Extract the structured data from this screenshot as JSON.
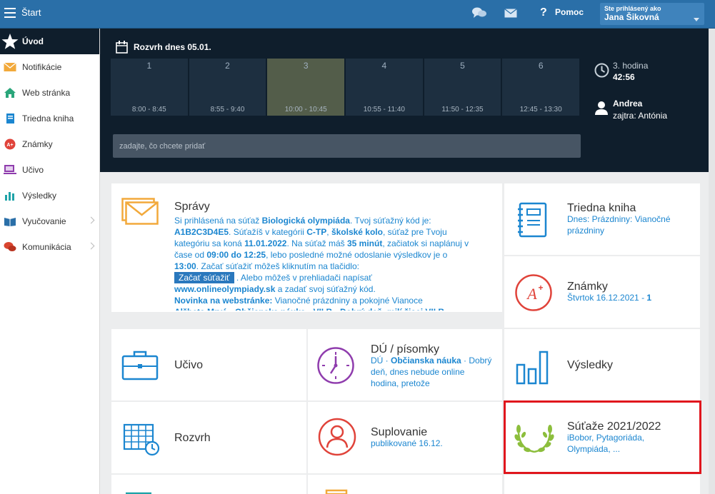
{
  "topbar": {
    "title": "Štart",
    "help_label": "Pomoc",
    "help_icon": "?",
    "user_caption": "Ste prihlásený ako",
    "user_name": "Jana Šikovná"
  },
  "sidebar": {
    "items": [
      {
        "label": "Úvod",
        "icon": "star-icon"
      },
      {
        "label": "Notifikácie",
        "icon": "envelope-icon"
      },
      {
        "label": "Web stránka",
        "icon": "home-icon"
      },
      {
        "label": "Triedna kniha",
        "icon": "book-icon"
      },
      {
        "label": "Známky",
        "icon": "grade-icon"
      },
      {
        "label": "Učivo",
        "icon": "monitor-icon"
      },
      {
        "label": "Výsledky",
        "icon": "chart-icon"
      },
      {
        "label": "Vyučovanie",
        "icon": "open-book-icon"
      },
      {
        "label": "Komunikácia",
        "icon": "chat-icon"
      }
    ]
  },
  "schedule": {
    "title": "Rozvrh dnes 05.01.",
    "slots": [
      {
        "num": "1",
        "time": "8:00 - 8:45"
      },
      {
        "num": "2",
        "time": "8:55 - 9:40"
      },
      {
        "num": "3",
        "time": "10:00 - 10:45"
      },
      {
        "num": "4",
        "time": "10:55 - 11:40"
      },
      {
        "num": "5",
        "time": "11:50 - 12:35"
      },
      {
        "num": "6",
        "time": "12:45 - 13:30"
      }
    ],
    "current_lesson": "3. hodina",
    "remaining": "42:56",
    "nameday_today": "Andrea",
    "nameday_tomorrow": "zajtra: Antónia",
    "input_placeholder": "zadajte, čo chcete pridať"
  },
  "tiles": {
    "spravy": {
      "title": "Správy",
      "p1": "Si prihlásená na súťaž ",
      "p1b": "Biologická olympiáda",
      "p2": ". Tvoj súťažný kód je: ",
      "code": "A1B2C3D4E5",
      "p3": ". Súťažíš v kategórii ",
      "category": "C-TP",
      "p4": ", ",
      "level": "školské kolo",
      "p5": ", súťaž pre Tvoju kategóriu sa koná ",
      "date": "11.01.2022",
      "p6": ". Na súťaž máš ",
      "duration": "35 minút",
      "p7": ", začiatok si naplánuj v čase od ",
      "time_from": "09:00 do 12:25",
      "p8": ", lebo posledné možné odoslanie výsledkov je o ",
      "deadline": "13:00",
      "p9": ". Začať súťažiť môžeš kliknutím na tlačidlo:",
      "start_button": "Začať súťažiť",
      "p10": " . Alebo môžeš v prehliadači napísať",
      "site": "www.onlineolympiady.sk",
      "p11": " a zadať svoj súťažný kód.",
      "news_b": "Novinka na webstránke:",
      "news": " Vianočné prázdniny a pokojné Vianoce",
      "cut_line": "Alžbeta Mrvá • Občianska náuka • VII.B • Dobrý deň, milí žiaci VII.B"
    },
    "triedna": {
      "title": "Triedna kniha",
      "sub": "Dnes: Prázdniny: Vianočné prázdniny"
    },
    "znamky": {
      "title": "Známky",
      "sub_date": "Štvrtok 16.12.2021 - ",
      "sub_grade": "1"
    },
    "ucivo": {
      "title": "Učivo"
    },
    "du": {
      "title": "DÚ / písomky",
      "sub_a": "DÚ · ",
      "sub_subject": "Občianska náuka",
      "sub_b": " · Dobrý deň, dnes nebude online hodina, pretože"
    },
    "vysledky": {
      "title": "Výsledky"
    },
    "rozvrh": {
      "title": "Rozvrh"
    },
    "suplovanie": {
      "title": "Suplovanie",
      "sub": "publikované 16.12."
    },
    "sutaze": {
      "title": "Súťaže 2021/2022",
      "sub": "iBobor, Pytagoriáda, Olympiáda, ..."
    }
  },
  "colors": {
    "topbar": "#2a6fa8",
    "dark_panel": "#0f1e2c",
    "accent_blue": "#1b86d0",
    "orange": "#f2a93b",
    "red_icon": "#e0433a",
    "purple": "#8f3cad",
    "green": "#8cbe3c",
    "highlight_frame": "#e0161d"
  }
}
